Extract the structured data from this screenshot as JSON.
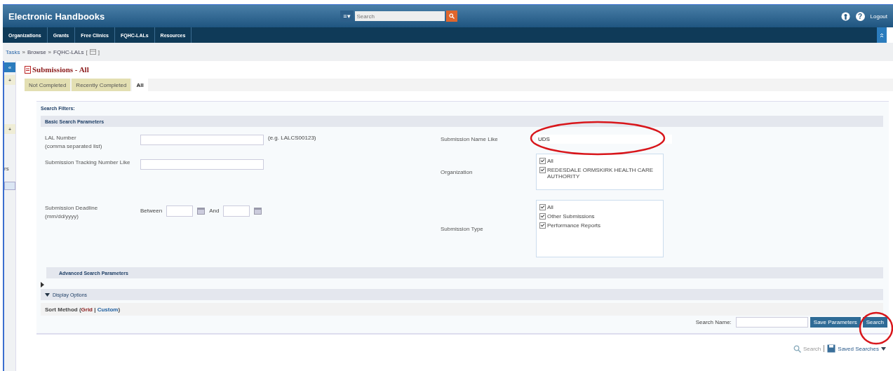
{
  "header": {
    "title": "Electronic Handbooks",
    "search": {
      "placeholder": "Search"
    },
    "menu_icon": "≡▾",
    "help_icon": "?",
    "logout": "Logout"
  },
  "nav": [
    {
      "label": "Organizations",
      "selected": false
    },
    {
      "label": "Grants",
      "selected": false
    },
    {
      "label": "Free Clinics",
      "selected": false
    },
    {
      "label": "FQHC-LALs",
      "selected": false
    },
    {
      "label": "Resources",
      "selected": false
    }
  ],
  "breadcrumb": [
    "Tasks",
    "Browse",
    "FQHC-LALs"
  ],
  "breadcrumb_separator": "»",
  "bookmark_open": "[",
  "bookmark_close": "]",
  "sidebar": {
    "collapse": "«",
    "items": [
      "+",
      "+"
    ],
    "cut_text": "rs"
  },
  "page_title": "Submissions - All",
  "tabs": [
    {
      "label": "Not Completed",
      "selected": false
    },
    {
      "label": "Recently Completed",
      "selected": false
    },
    {
      "label": "All",
      "selected": true
    }
  ],
  "filters": {
    "title": "Search Filters:",
    "basic": "Basic Search Parameters",
    "lal_label": "LAL Number",
    "lal_hint": "(comma separated list)",
    "lal_example": "(e.g. LALCS00123)",
    "tracking_label": "Submission Tracking Number Like",
    "deadline_label": "Submission Deadline",
    "deadline_hint": "(mm/dd/yyyy)",
    "between": "Between",
    "and": "And",
    "name_label": "Submission Name Like",
    "name_value": "UDS",
    "org_label": "Organization",
    "org_options": [
      {
        "label": "All",
        "checked": true
      },
      {
        "label": "REDESDALE ORMSKIRK HEALTH CARE AUTHORITY",
        "checked": true
      }
    ],
    "type_label": "Submission Type",
    "type_options": [
      {
        "label": "All",
        "checked": true
      },
      {
        "label": "Other Submissions",
        "checked": true
      },
      {
        "label": "Performance Reports",
        "checked": true
      }
    ],
    "advanced": "Advanced Search Parameters",
    "display": "Display Options",
    "sort_label": "Sort Method (",
    "sort_grid": "Grid",
    "sort_sep": "|",
    "sort_custom": "Custom",
    "sort_end": ")"
  },
  "actions": {
    "search_name_label": "Search Name:",
    "save": "Save Parameters",
    "search": "Search"
  },
  "footer": {
    "search_link": "Search",
    "saved": "Saved Searches"
  }
}
